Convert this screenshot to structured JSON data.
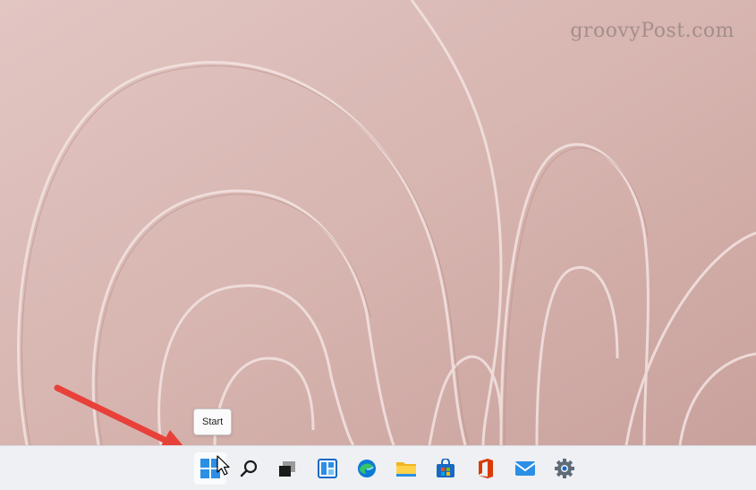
{
  "watermark": "groovyPost.com",
  "tooltip": {
    "text": "Start"
  },
  "taskbar": {
    "items": [
      {
        "name": "start-button",
        "icon": "windows-start-icon"
      },
      {
        "name": "search-button",
        "icon": "search-icon"
      },
      {
        "name": "task-view-button",
        "icon": "task-view-icon"
      },
      {
        "name": "widgets-button",
        "icon": "widgets-icon"
      },
      {
        "name": "edge-button",
        "icon": "edge-icon"
      },
      {
        "name": "file-explorer-button",
        "icon": "folder-icon"
      },
      {
        "name": "store-button",
        "icon": "store-icon"
      },
      {
        "name": "office-button",
        "icon": "office-icon"
      },
      {
        "name": "mail-button",
        "icon": "mail-icon"
      },
      {
        "name": "settings-button",
        "icon": "gear-icon"
      }
    ]
  },
  "colors": {
    "wallpaper": "#d9b8b4",
    "taskbar": "#eef0f4",
    "accent": "#0a74da",
    "arrow": "#e8413a"
  }
}
